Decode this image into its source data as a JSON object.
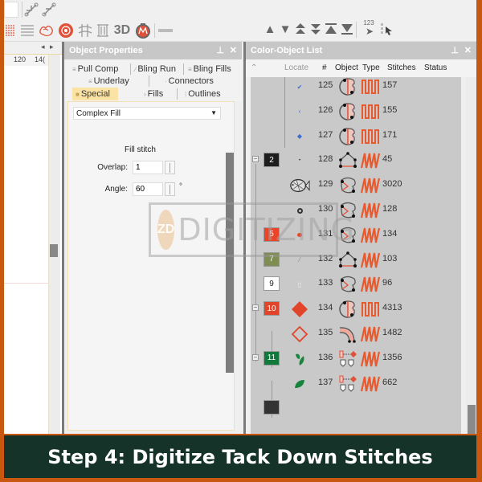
{
  "toolbar_top": {
    "icons": [
      "node-edit-icon",
      "node-reshape-icon"
    ]
  },
  "toolbar_stitch": {
    "icons": [
      "satin-fill-icon",
      "tatami-lines-icon",
      "motif-fill-icon",
      "radial-fill-icon",
      "contour-stitch-icon",
      "cross-stitch-icon",
      "3d-icon",
      "monogram-icon",
      "separator-icon"
    ],
    "label_3d": "3D"
  },
  "toolbar_sequence": {
    "icons": [
      "move-to-start-icon",
      "move-to-end-icon",
      "move-up-icon",
      "move-down-icon",
      "move-first-icon",
      "move-last-icon",
      "sequence-by-number-icon",
      "sequence-by-color-icon"
    ],
    "seq_number_label": "123"
  },
  "canvas": {
    "ruler_labels": [
      "120",
      "14("
    ]
  },
  "object_properties": {
    "title": "Object Properties",
    "tabs": [
      {
        "label": "Pull Comp",
        "active": false
      },
      {
        "label": "Bling Run",
        "active": false
      },
      {
        "label": "Bling Fills",
        "active": false
      },
      {
        "label": "Underlay",
        "active": false
      },
      {
        "label": "Connectors",
        "active": false
      },
      {
        "label": "Special",
        "active": true
      },
      {
        "label": "Fills",
        "active": false
      },
      {
        "label": "Outlines",
        "active": false
      }
    ],
    "fill_type_selected": "Complex Fill",
    "section_title": "Fill stitch",
    "overlap_label": "Overlap:",
    "overlap_value": "1",
    "angle_label": "Angle:",
    "angle_value": "60",
    "angle_unit": "°"
  },
  "color_object_list": {
    "title": "Color-Object List",
    "columns": [
      "Locate",
      "#",
      "Object",
      "Type",
      "Stitches",
      "Status"
    ],
    "rows": [
      {
        "color_block": null,
        "num": "125",
        "object": "complex-fill",
        "type": "fill",
        "stitches": "157"
      },
      {
        "color_block": null,
        "num": "126",
        "object": "complex-fill",
        "type": "fill",
        "stitches": "155"
      },
      {
        "color_block": null,
        "num": "127",
        "object": "complex-fill",
        "type": "fill",
        "stitches": "171"
      },
      {
        "color_block": "2",
        "num": "128",
        "object": "input-a",
        "type": "satin",
        "stitches": "45"
      },
      {
        "color_block": null,
        "num": "129",
        "object": "closed-shape",
        "type": "satin",
        "stitches": "3020"
      },
      {
        "color_block": null,
        "num": "130",
        "object": "closed-shape",
        "type": "satin",
        "stitches": "128"
      },
      {
        "color_block": "5",
        "num": "131",
        "object": "closed-shape",
        "type": "satin",
        "stitches": "134"
      },
      {
        "color_block": "7",
        "num": "132",
        "object": "input-a",
        "type": "satin",
        "stitches": "103"
      },
      {
        "color_block": "9",
        "num": "133",
        "object": "closed-shape",
        "type": "satin",
        "stitches": "96"
      },
      {
        "color_block": "10",
        "num": "134",
        "object": "complex-fill",
        "type": "fill",
        "stitches": "4313"
      },
      {
        "color_block": null,
        "num": "135",
        "object": "column",
        "type": "satin",
        "stitches": "1482"
      },
      {
        "color_block": "11",
        "num": "136",
        "object": "applique",
        "type": "satin",
        "stitches": "1356"
      },
      {
        "color_block": null,
        "num": "137",
        "object": "applique",
        "type": "satin",
        "stitches": "662"
      }
    ],
    "swatch_colors": {
      "2": "#1e1e1e",
      "5": "#e9452a",
      "7": "#7f8c52",
      "9": "#ffffff",
      "10": "#e0442a",
      "11": "#11793a"
    }
  },
  "watermark": {
    "logo": "ZD",
    "text": "DIGITIZING"
  },
  "caption": "Step 4: Digitize Tack Down Stitches"
}
